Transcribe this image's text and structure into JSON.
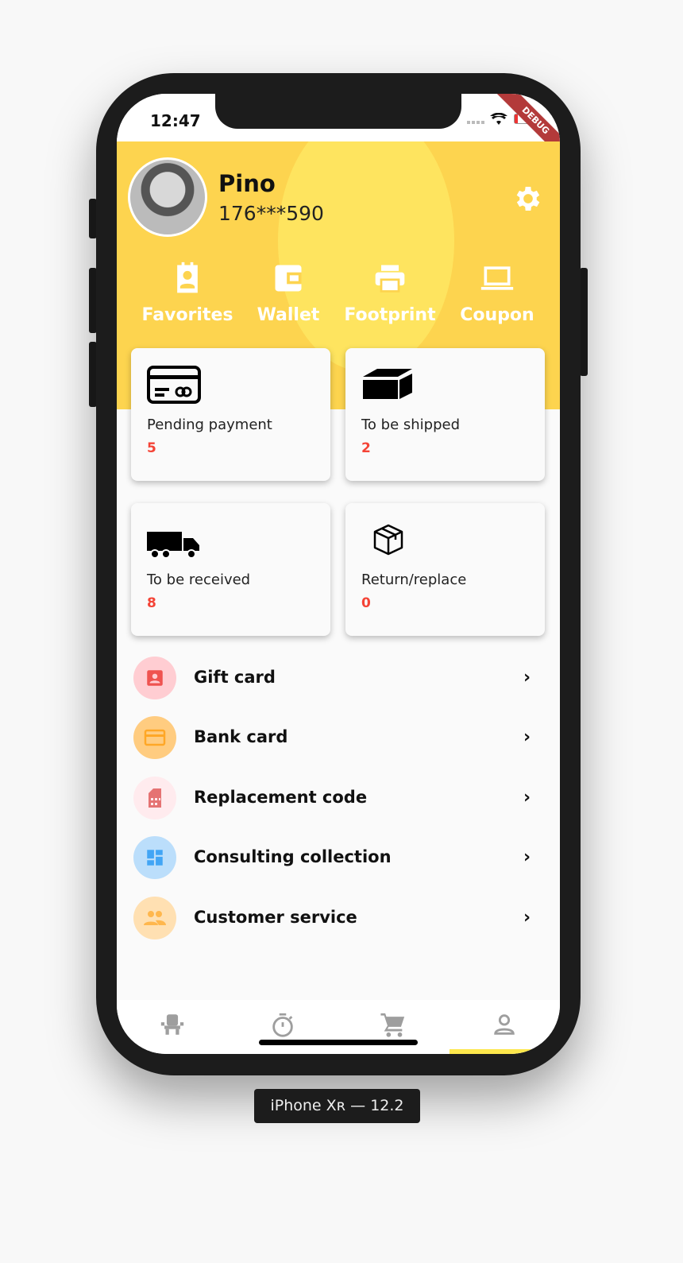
{
  "status_bar": {
    "time": "12:47",
    "debug_banner": "DEBUG"
  },
  "profile": {
    "name": "Pino",
    "phone": "176***590"
  },
  "quick_actions": [
    {
      "label": "Favorites",
      "icon": "contact-calendar-icon"
    },
    {
      "label": "Wallet",
      "icon": "wallet-icon"
    },
    {
      "label": "Footprint",
      "icon": "printer-icon"
    },
    {
      "label": "Coupon",
      "icon": "laptop-icon"
    }
  ],
  "orders": [
    {
      "label": "Pending payment",
      "count": "5",
      "icon": "credit-card-icon"
    },
    {
      "label": "To be shipped",
      "count": "2",
      "icon": "box-icon"
    },
    {
      "label": "To be received",
      "count": "8",
      "icon": "truck-icon"
    },
    {
      "label": "Return/replace",
      "count": "0",
      "icon": "package-icon"
    }
  ],
  "menu": [
    {
      "label": "Gift card",
      "icon": "contact-icon",
      "bg": "#ffcdd2",
      "fg": "#ef5350"
    },
    {
      "label": "Bank card",
      "icon": "card-icon",
      "bg": "#ffcc80",
      "fg": "#ffa726"
    },
    {
      "label": "Replacement code",
      "icon": "sim-card-icon",
      "bg": "#ffebee",
      "fg": "#e57373"
    },
    {
      "label": "Consulting collection",
      "icon": "dashboard-icon",
      "bg": "#bbdefb",
      "fg": "#42a5f5"
    },
    {
      "label": "Customer service",
      "icon": "people-icon",
      "bg": "#ffe0b2",
      "fg": "#ffb74d"
    }
  ],
  "bottom_nav": [
    {
      "icon": "seat-icon"
    },
    {
      "icon": "timer-icon"
    },
    {
      "icon": "cart-icon"
    },
    {
      "icon": "person-icon",
      "active": true
    }
  ],
  "colors": {
    "header": "#fdd44f",
    "accent": "#fde74c",
    "count": "#f44336"
  },
  "device_label": "iPhone Xʀ — 12.2"
}
